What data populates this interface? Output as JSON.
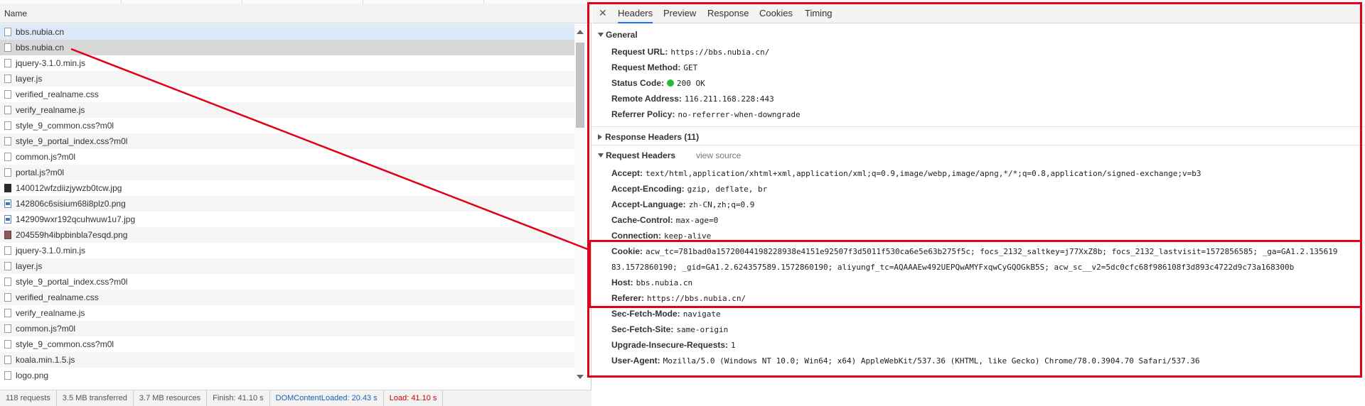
{
  "list": {
    "header": "Name",
    "rows": [
      {
        "name": "bbs.nubia.cn",
        "icon": "file"
      },
      {
        "name": "bbs.nubia.cn",
        "icon": "file"
      },
      {
        "name": "jquery-3.1.0.min.js",
        "icon": "file"
      },
      {
        "name": "layer.js",
        "icon": "file"
      },
      {
        "name": "verified_realname.css",
        "icon": "file"
      },
      {
        "name": "verify_realname.js",
        "icon": "file"
      },
      {
        "name": "style_9_common.css?m0l",
        "icon": "file"
      },
      {
        "name": "style_9_portal_index.css?m0l",
        "icon": "file"
      },
      {
        "name": "common.js?m0l",
        "icon": "file"
      },
      {
        "name": "portal.js?m0l",
        "icon": "file"
      },
      {
        "name": "140012wfzdiizjywzb0tcw.jpg",
        "icon": "image-dark"
      },
      {
        "name": "142806c6sisium68i8plz0.png",
        "icon": "image-blue"
      },
      {
        "name": "142909wxr192qcuhwuw1u7.jpg",
        "icon": "image-blue"
      },
      {
        "name": "204559h4ibpbinbla7esqd.png",
        "icon": "image-red"
      },
      {
        "name": "jquery-3.1.0.min.js",
        "icon": "file"
      },
      {
        "name": "layer.js",
        "icon": "file"
      },
      {
        "name": "style_9_portal_index.css?m0l",
        "icon": "file"
      },
      {
        "name": "verified_realname.css",
        "icon": "file"
      },
      {
        "name": "verify_realname.js",
        "icon": "file"
      },
      {
        "name": "common.js?m0l",
        "icon": "file"
      },
      {
        "name": "style_9_common.css?m0l",
        "icon": "file"
      },
      {
        "name": "koala.min.1.5.js",
        "icon": "file"
      },
      {
        "name": "logo.png",
        "icon": "file"
      }
    ]
  },
  "statusbar": {
    "requests": "118 requests",
    "transferred": "3.5 MB transferred",
    "resources": "3.7 MB resources",
    "finish": "Finish: 41.10 s",
    "domcontentloaded": "DOMContentLoaded: 20.43 s",
    "load": "Load: 41.10 s"
  },
  "tabs": [
    "Headers",
    "Preview",
    "Response",
    "Cookies",
    "Timing"
  ],
  "general": {
    "title": "General",
    "items": [
      {
        "key": "Request URL:",
        "value": "https://bbs.nubia.cn/"
      },
      {
        "key": "Request Method:",
        "value": "GET"
      },
      {
        "key": "Status Code:",
        "value": "200 OK"
      },
      {
        "key": "Remote Address:",
        "value": "116.211.168.228:443"
      },
      {
        "key": "Referrer Policy:",
        "value": "no-referrer-when-downgrade"
      }
    ]
  },
  "response_headers": {
    "title": "Response Headers (11)"
  },
  "request_headers": {
    "title": "Request Headers",
    "view_source": "view source",
    "items": [
      {
        "key": "Accept:",
        "value": "text/html,application/xhtml+xml,application/xml;q=0.9,image/webp,image/apng,*/*;q=0.8,application/signed-exchange;v=b3"
      },
      {
        "key": "Accept-Encoding:",
        "value": "gzip, deflate, br"
      },
      {
        "key": "Accept-Language:",
        "value": "zh-CN,zh;q=0.9"
      },
      {
        "key": "Cache-Control:",
        "value": "max-age=0"
      },
      {
        "key": "Connection:",
        "value": "keep-alive"
      }
    ],
    "cookie_key": "Cookie:",
    "cookie_line1": "acw_tc=781bad0a15720044198228938e4151e92507f3d5011f530ca6e5e63b275f5c; focs_2132_saltkey=j77XxZ8b; focs_2132_lastvisit=1572856585; _ga=GA1.2.135619",
    "cookie_line2": "83.1572860190; _gid=GA1.2.624357589.1572860190; aliyungf_tc=AQAAAEw492UEPQwAMYFxqwCyGQOGkB5S; acw_sc__v2=5dc0cfc68f986108f3d893c4722d9c73a168300b",
    "items2": [
      {
        "key": "Host:",
        "value": "bbs.nubia.cn"
      },
      {
        "key": "Referer:",
        "value": "https://bbs.nubia.cn/"
      },
      {
        "key": "Sec-Fetch-Mode:",
        "value": "navigate"
      },
      {
        "key": "Sec-Fetch-Site:",
        "value": "same-origin"
      },
      {
        "key": "Upgrade-Insecure-Requests:",
        "value": "1"
      },
      {
        "key": "User-Agent:",
        "value": "Mozilla/5.0 (Windows NT 10.0; Win64; x64) AppleWebKit/537.36 (KHTML, like Gecko) Chrome/78.0.3904.70 Safari/537.36"
      }
    ]
  },
  "colors": {
    "annotation": "#e0001a",
    "status_ok": "#2db83d",
    "tab_active": "#1a73e8"
  }
}
